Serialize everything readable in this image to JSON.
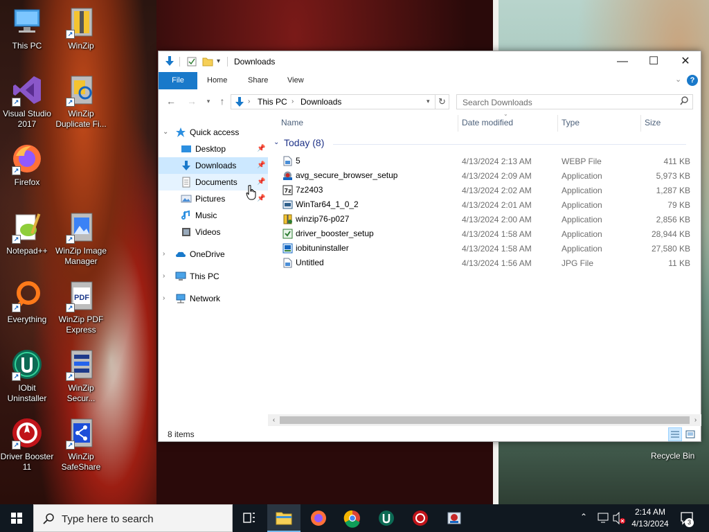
{
  "desktop": {
    "icons_left": [
      {
        "label": "This PC",
        "icon": "this-pc-icon"
      },
      {
        "label": "Visual Studio 2017",
        "icon": "visual-studio-icon"
      },
      {
        "label": "Firefox",
        "icon": "firefox-icon"
      },
      {
        "label": "Notepad++",
        "icon": "notepadpp-icon"
      },
      {
        "label": "Everything",
        "icon": "everything-icon"
      },
      {
        "label": "IObit Uninstaller",
        "icon": "iobit-uninstaller-icon"
      },
      {
        "label": "Driver Booster 11",
        "icon": "driver-booster-icon"
      }
    ],
    "icons_right": [
      {
        "label": "WinZip",
        "icon": "winzip-icon"
      },
      {
        "label": "WinZip Duplicate Fi...",
        "icon": "winzip-duplicate-icon"
      },
      {
        "label": "WinZip Image Manager",
        "icon": "winzip-image-icon"
      },
      {
        "label": "WinZip PDF Express",
        "icon": "winzip-pdf-icon"
      },
      {
        "label": "WinZip Secur...",
        "icon": "winzip-secure-icon"
      },
      {
        "label": "WinZip SafeShare",
        "icon": "winzip-safeshare-icon"
      }
    ],
    "recycle_bin": "Recycle Bin",
    "pdf_badge": "PDF"
  },
  "window": {
    "title": "Downloads",
    "ribbon_tabs": [
      "File",
      "Home",
      "Share",
      "View"
    ],
    "address": {
      "root": "This PC",
      "current": "Downloads"
    },
    "search_placeholder": "Search Downloads",
    "help_glyph": "?",
    "nav": {
      "quick_access": "Quick access",
      "pinned": [
        {
          "label": "Desktop"
        },
        {
          "label": "Downloads"
        },
        {
          "label": "Documents"
        },
        {
          "label": "Pictures"
        },
        {
          "label": "Music"
        },
        {
          "label": "Videos"
        }
      ],
      "onedrive": "OneDrive",
      "this_pc": "This PC",
      "network": "Network"
    },
    "columns": {
      "name": "Name",
      "date": "Date modified",
      "type": "Type",
      "size": "Size"
    },
    "group_label": "Today (8)",
    "files": [
      {
        "name": "5",
        "date": "4/13/2024 2:13 AM",
        "type": "WEBP File",
        "size": "411 KB",
        "icon": "webp-file-icon"
      },
      {
        "name": "avg_secure_browser_setup",
        "date": "4/13/2024 2:09 AM",
        "type": "Application",
        "size": "5,973 KB",
        "icon": "avg-setup-icon"
      },
      {
        "name": "7z2403",
        "date": "4/13/2024 2:02 AM",
        "type": "Application",
        "size": "1,287 KB",
        "icon": "7zip-icon"
      },
      {
        "name": "WinTar64_1_0_2",
        "date": "4/13/2024 2:01 AM",
        "type": "Application",
        "size": "79 KB",
        "icon": "wintar-icon"
      },
      {
        "name": "winzip76-p027",
        "date": "4/13/2024 2:00 AM",
        "type": "Application",
        "size": "2,856 KB",
        "icon": "winzip-setup-icon"
      },
      {
        "name": "driver_booster_setup",
        "date": "4/13/2024 1:58 AM",
        "type": "Application",
        "size": "28,944 KB",
        "icon": "driver-booster-setup-icon"
      },
      {
        "name": "iobituninstaller",
        "date": "4/13/2024 1:58 AM",
        "type": "Application",
        "size": "27,580 KB",
        "icon": "iobit-setup-icon"
      },
      {
        "name": "Untitled",
        "date": "4/13/2024 1:56 AM",
        "type": "JPG File",
        "size": "11 KB",
        "icon": "jpg-file-icon"
      }
    ],
    "status": "8 items"
  },
  "taskbar": {
    "search_placeholder": "Type here to search",
    "time": "2:14 AM",
    "date": "4/13/2024",
    "notification_count": "3"
  },
  "colors": {
    "accent": "#1979ca",
    "selection": "#cce8ff",
    "group_header": "#1e3287",
    "taskbar": "#101820"
  }
}
